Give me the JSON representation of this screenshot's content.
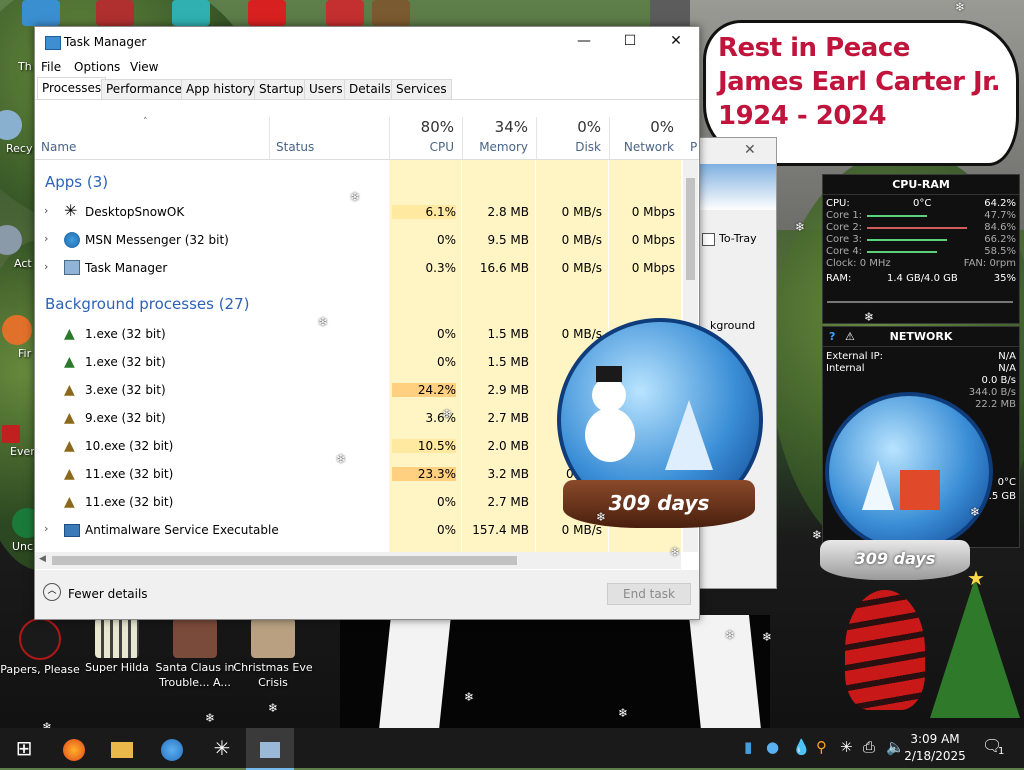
{
  "desktop": {
    "rip_lines": [
      "Rest in Peace",
      "James Earl Carter Jr.",
      "1924 - 2024"
    ],
    "icons": [
      {
        "label": "Papers, Please",
        "color": "#b01818"
      },
      {
        "label": "Super Hilda",
        "color": "#d8d8c0"
      },
      {
        "label": "Santa Claus in Trouble... A...",
        "color": "#7a4a3a"
      },
      {
        "label": "Christmas Eve Crisis",
        "color": "#b8a080"
      }
    ],
    "edge_icons": [
      "Th",
      "Recy",
      "Act",
      "Fir",
      "Ever",
      "Unc"
    ],
    "globe_label_1": "309 days",
    "globe_label_2": "309 days",
    "tray_to_tray": "To-Tray",
    "partial_background": "kground"
  },
  "task_manager": {
    "title": "Task Manager",
    "menu": [
      "File",
      "Options",
      "View"
    ],
    "tabs": [
      "Processes",
      "Performance",
      "App history",
      "Startup",
      "Users",
      "Details",
      "Services"
    ],
    "active_tab": "Processes",
    "columns": {
      "name": "Name",
      "status": "Status",
      "cpu": {
        "pct": "80%",
        "label": "CPU"
      },
      "memory": {
        "pct": "34%",
        "label": "Memory"
      },
      "disk": {
        "pct": "0%",
        "label": "Disk"
      },
      "network": {
        "pct": "0%",
        "label": "Network"
      },
      "power": "P"
    },
    "apps_header": "Apps (3)",
    "background_header": "Background processes (27)",
    "apps": [
      {
        "name": "DesktopSnowOK",
        "cpu": "6.1%",
        "mem": "2.8 MB",
        "disk": "0 MB/s",
        "net": "0 Mbps"
      },
      {
        "name": "MSN Messenger (32 bit)",
        "cpu": "0%",
        "mem": "9.5 MB",
        "disk": "0 MB/s",
        "net": "0 Mbps"
      },
      {
        "name": "Task Manager",
        "cpu": "0.3%",
        "mem": "16.6 MB",
        "disk": "0 MB/s",
        "net": "0 Mbps"
      }
    ],
    "background": [
      {
        "name": "1.exe (32 bit)",
        "cpu": "0%",
        "mem": "1.5 MB",
        "disk": "0 MB/s"
      },
      {
        "name": "1.exe (32 bit)",
        "cpu": "0%",
        "mem": "1.5 MB",
        "disk": "0 M"
      },
      {
        "name": "3.exe (32 bit)",
        "cpu": "24.2%",
        "mem": "2.9 MB",
        "disk": ""
      },
      {
        "name": "9.exe (32 bit)",
        "cpu": "3.6%",
        "mem": "2.7 MB",
        "disk": ""
      },
      {
        "name": "10.exe (32 bit)",
        "cpu": "10.5%",
        "mem": "2.0 MB",
        "disk": ""
      },
      {
        "name": "11.exe (32 bit)",
        "cpu": "23.3%",
        "mem": "3.2 MB",
        "disk": "0"
      },
      {
        "name": "11.exe (32 bit)",
        "cpu": "0%",
        "mem": "2.7 MB",
        "disk": "0"
      },
      {
        "name": "Antimalware Service Executable",
        "cpu": "0%",
        "mem": "157.4 MB",
        "disk": "0 MB/s"
      }
    ],
    "fewer_details": "Fewer details",
    "end_task": "End task"
  },
  "cpu_ram": {
    "title": "CPU-RAM",
    "cpu_label": "CPU:",
    "cpu_temp": "0°C",
    "cpu_pct": "64.2%",
    "cores": [
      {
        "label": "Core 1:",
        "pct": "47.7%"
      },
      {
        "label": "Core 2:",
        "pct": "84.6%"
      },
      {
        "label": "Core 3:",
        "pct": "66.2%"
      },
      {
        "label": "Core 4:",
        "pct": "58.5%"
      }
    ],
    "clock": "Clock: 0 MHz",
    "fan": "FAN: 0rpm",
    "ram_label": "RAM:",
    "ram_val": "1.4 GB/4.0 GB",
    "ram_pct": "35%"
  },
  "network": {
    "title": "NETWORK",
    "external_ip_label": "External IP:",
    "external_ip": "N/A",
    "internal_label": "Internal",
    "internal_ip": "N/A",
    "rate1": "0.0 B/s",
    "rate2": "344.0 B/s",
    "rate3": "22.2 MB",
    "temp": "0°C",
    "size": "9.5 GB"
  },
  "taskbar": {
    "time": "3:09 AM",
    "date": "2/18/2025",
    "notification_count": "1"
  }
}
